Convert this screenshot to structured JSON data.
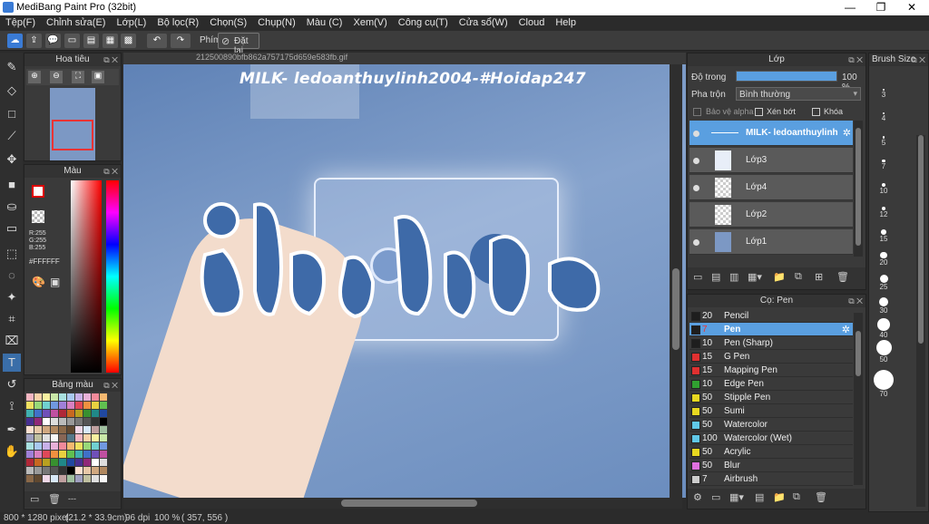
{
  "window": {
    "title": "MediBang Paint Pro (32bit)",
    "controls": [
      "—",
      "❐",
      "✕"
    ]
  },
  "menu": [
    "Tệp(F)",
    "Chỉnh sửa(E)",
    "Lớp(L)",
    "Bộ lọc(R)",
    "Chọn(S)",
    "Chụp(N)",
    "Màu (C)",
    "Xem(V)",
    "Công cụ(T)",
    "Cửa sổ(W)",
    "Cloud",
    "Help"
  ],
  "toolbar": {
    "shortcut_label": "Phím",
    "reset_label": "Đặt lại"
  },
  "navigator": {
    "title": "Hoa tiêu"
  },
  "color_panel": {
    "title": "Màu",
    "r": "R:255",
    "g": "G:255",
    "b": "B:255",
    "hex": "#FFFFFF"
  },
  "palette": {
    "title": "Bảng màu",
    "footer": "---"
  },
  "canvas": {
    "tab_name": "212500890bfb862a757175d659e583fb.gif",
    "watermark": "MILK- ledoanthuylinh2004-#Hoidap247"
  },
  "layers": {
    "title": "Lớp",
    "opacity_label": "Độ trong",
    "opacity_value": "100 %",
    "opacity": 1.0,
    "blend_label": "Pha trộn",
    "blend_value": "Bình thường",
    "protect_alpha": "Bảo vệ alpha",
    "clip": "Xén bớt",
    "lock": "Khóa",
    "items": [
      {
        "name": "MILK- ledoanthuylinh",
        "selected": true
      },
      {
        "name": "Lớp3",
        "selected": false
      },
      {
        "name": "Lớp4",
        "selected": false
      },
      {
        "name": "Lớp2",
        "selected": false
      },
      {
        "name": "Lớp1",
        "selected": false
      }
    ]
  },
  "brushes": {
    "title": "Cọ: Pen",
    "items": [
      {
        "size": "20",
        "name": "Pencil",
        "color": "#1e1e1e"
      },
      {
        "size": "7",
        "name": "Pen",
        "color": "#1e1e1e",
        "selected": true
      },
      {
        "size": "10",
        "name": "Pen (Sharp)",
        "color": "#1e1e1e"
      },
      {
        "size": "15",
        "name": "G Pen",
        "color": "#e03030"
      },
      {
        "size": "15",
        "name": "Mapping Pen",
        "color": "#e03030"
      },
      {
        "size": "10",
        "name": "Edge Pen",
        "color": "#30a030"
      },
      {
        "size": "50",
        "name": "Stipple Pen",
        "color": "#e8d820"
      },
      {
        "size": "50",
        "name": "Sumi",
        "color": "#e8d820"
      },
      {
        "size": "50",
        "name": "Watercolor",
        "color": "#60c8e8"
      },
      {
        "size": "100",
        "name": "Watercolor (Wet)",
        "color": "#60c8e8"
      },
      {
        "size": "50",
        "name": "Acrylic",
        "color": "#e8d820"
      },
      {
        "size": "50",
        "name": "Blur",
        "color": "#e070e0"
      },
      {
        "size": "7",
        "name": "Airbrush",
        "color": "#cccccc"
      }
    ]
  },
  "brush_size": {
    "title": "Brush Size",
    "sizes": [
      "3",
      "4",
      "5",
      "7",
      "10",
      "12",
      "15",
      "20",
      "25",
      "30",
      "40",
      "50",
      "70"
    ]
  },
  "status": {
    "dimensions": "800 * 1280 pixel",
    "physical": "(21.2 * 33.9cm)",
    "dpi": "96 dpi",
    "zoom": "100 %",
    "coords": "( 357, 556 )"
  },
  "colors": {
    "accent": "#3a7bd5",
    "selection": "#5a9fe0",
    "canvas_bg": "#6a8cbd"
  }
}
